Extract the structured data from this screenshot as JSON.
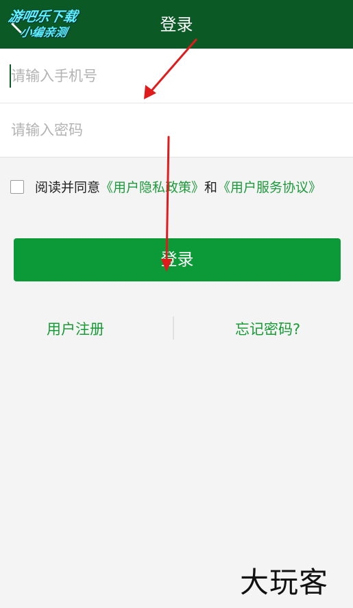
{
  "header": {
    "title": "登录",
    "watermark_line1": "游吧乐下载",
    "watermark_line2": "小编亲测",
    "background_color": "#0b5a26"
  },
  "form": {
    "phone_placeholder": "请输入手机号",
    "password_placeholder": "请输入密码",
    "phone_value": "",
    "password_value": ""
  },
  "agreement": {
    "checked": false,
    "prefix": "阅读并同意",
    "privacy_link": "《用户隐私政策》",
    "conjunction": "和",
    "service_link": "《用户服务协议》"
  },
  "actions": {
    "login_label": "登录",
    "register_label": "用户注册",
    "forgot_label": "忘记密码?"
  },
  "colors": {
    "primary_button": "#0b9a37",
    "link": "#1c9a3b",
    "annotation_arrow": "#e01b1b"
  },
  "footer": {
    "brand": "大玩客"
  }
}
